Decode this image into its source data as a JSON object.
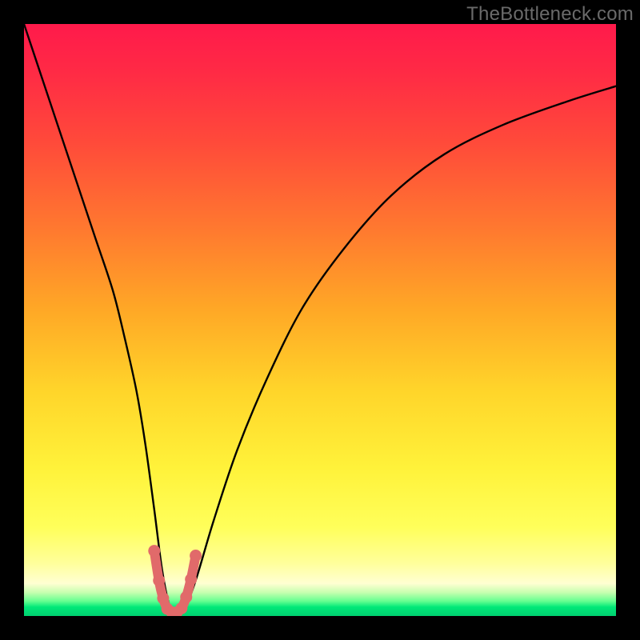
{
  "watermark": "TheBottleneck.com",
  "chart_data": {
    "type": "line",
    "title": "",
    "xlabel": "",
    "ylabel": "",
    "xlim": [
      0,
      100
    ],
    "ylim": [
      0,
      100
    ],
    "gradient_stops": [
      {
        "pct": 0,
        "color": "#ff1a4b"
      },
      {
        "pct": 8,
        "color": "#ff2a45"
      },
      {
        "pct": 20,
        "color": "#ff4a3a"
      },
      {
        "pct": 35,
        "color": "#ff7a2f"
      },
      {
        "pct": 48,
        "color": "#ffa726"
      },
      {
        "pct": 62,
        "color": "#ffd52a"
      },
      {
        "pct": 75,
        "color": "#fff23a"
      },
      {
        "pct": 85,
        "color": "#ffff5a"
      },
      {
        "pct": 91,
        "color": "#ffff9a"
      },
      {
        "pct": 94.5,
        "color": "#ffffd2"
      },
      {
        "pct": 96,
        "color": "#c8ffb0"
      },
      {
        "pct": 97.5,
        "color": "#64ff90"
      },
      {
        "pct": 98.5,
        "color": "#00e878"
      },
      {
        "pct": 100,
        "color": "#00d070"
      }
    ],
    "series": [
      {
        "name": "bottleneck-curve",
        "color": "#000000",
        "x": [
          0,
          3,
          6,
          9,
          12,
          15,
          17,
          19,
          20.5,
          22,
          23.3,
          24.5,
          25.5,
          27,
          29,
          32,
          36,
          41,
          47,
          54,
          62,
          71,
          81,
          92,
          100
        ],
        "y": [
          100,
          91,
          82,
          73,
          64,
          55,
          47,
          38,
          29,
          18,
          8,
          2,
          0.5,
          1,
          6,
          16,
          28,
          40,
          52,
          62,
          71,
          78,
          83,
          87,
          89.5
        ]
      }
    ],
    "highlight": {
      "name": "trough-marker",
      "color": "#e16a6a",
      "points": [
        {
          "x": 22.0,
          "y": 11
        },
        {
          "x": 22.8,
          "y": 6
        },
        {
          "x": 23.5,
          "y": 3
        },
        {
          "x": 24.2,
          "y": 1.2
        },
        {
          "x": 25.0,
          "y": 0.6
        },
        {
          "x": 25.8,
          "y": 0.6
        },
        {
          "x": 26.6,
          "y": 1.3
        },
        {
          "x": 27.4,
          "y": 3.2
        },
        {
          "x": 28.2,
          "y": 6.2
        },
        {
          "x": 29.0,
          "y": 10.2
        }
      ]
    }
  }
}
